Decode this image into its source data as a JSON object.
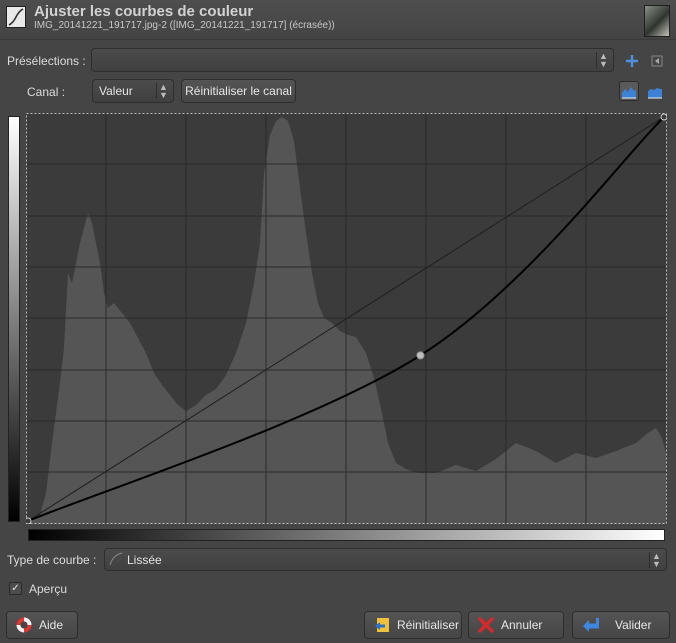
{
  "window": {
    "title": "Ajuster les courbes de couleur",
    "subtitle": "IMG_20141221_191717.jpg-2 ([IMG_20141221_191717] (écrasée))"
  },
  "presets": {
    "label": "Présélections :",
    "value": ""
  },
  "channel": {
    "label": "Canal :",
    "value": "Valeur",
    "reset_label": "Réinitialiser le canal"
  },
  "curve": {
    "points": [
      [
        0,
        0
      ],
      [
        0.617,
        0.41
      ],
      [
        1,
        1
      ]
    ]
  },
  "curve_type": {
    "label": "Type de courbe :",
    "value": "Lissée"
  },
  "preview": {
    "label": "Aperçu",
    "checked": true
  },
  "buttons": {
    "help": "Aide",
    "reset": "Réinitialiser",
    "cancel": "Annuler",
    "ok": "Valider"
  },
  "colors": {
    "background": "#454545",
    "graph_bg": "#3b3b3b",
    "histogram": "#555555",
    "curve": "#000000",
    "accent_blue": "#2f6fc4",
    "cancel_red": "#d8282b"
  }
}
